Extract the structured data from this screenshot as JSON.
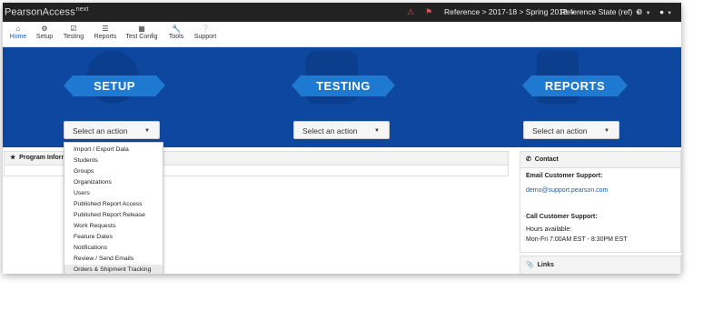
{
  "topbar": {
    "brand": "PearsonAccess",
    "brand_sup": "next",
    "alert_icon": "bell-icon",
    "flag_icon": "flag-icon",
    "context": "Reference > 2017-18 > Spring 2018",
    "state": "Reference State (ref)",
    "settings_icon": "gear-icon",
    "user_icon": "user-icon"
  },
  "nav": [
    {
      "label": "Home",
      "icon": "home-icon",
      "active": true
    },
    {
      "label": "Setup",
      "icon": "gear-icon"
    },
    {
      "label": "Testing",
      "icon": "checkbox-icon"
    },
    {
      "label": "Reports",
      "icon": "list-icon"
    },
    {
      "label": "Test Config",
      "icon": "table-icon"
    },
    {
      "label": "Tools",
      "icon": "wrench-icon"
    },
    {
      "label": "Support",
      "icon": "question-icon"
    }
  ],
  "hero": {
    "setup": {
      "title": "SETUP",
      "select": "Select an action"
    },
    "testing": {
      "title": "TESTING",
      "select": "Select an action"
    },
    "reports": {
      "title": "REPORTS",
      "select": "Select an action"
    }
  },
  "colors": {
    "hero_bg": "#0d47a0",
    "ribbon": "#1e79d1",
    "topbar": "#222222",
    "link": "#1a5fb4"
  },
  "program_info": {
    "title": "Program Inform"
  },
  "contact": {
    "title": "Contact",
    "email_label": "Email Customer Support:",
    "email": "demo@support.pearson.com",
    "call_label": "Call Customer Support:",
    "hours_label": "Hours available:",
    "hours": "Mon-Fri 7:00AM EST - 8:30PM EST"
  },
  "links": {
    "title": "Links"
  },
  "dropdown": {
    "items": [
      "Import / Export Data",
      "Students",
      "Groups",
      "Organizations",
      "Users",
      "Published Report Access",
      "Published Report Release",
      "Work Requests",
      "Feature Dates",
      "Notifications",
      "Review / Send Emails",
      "Orders & Shipment Tracking"
    ]
  }
}
